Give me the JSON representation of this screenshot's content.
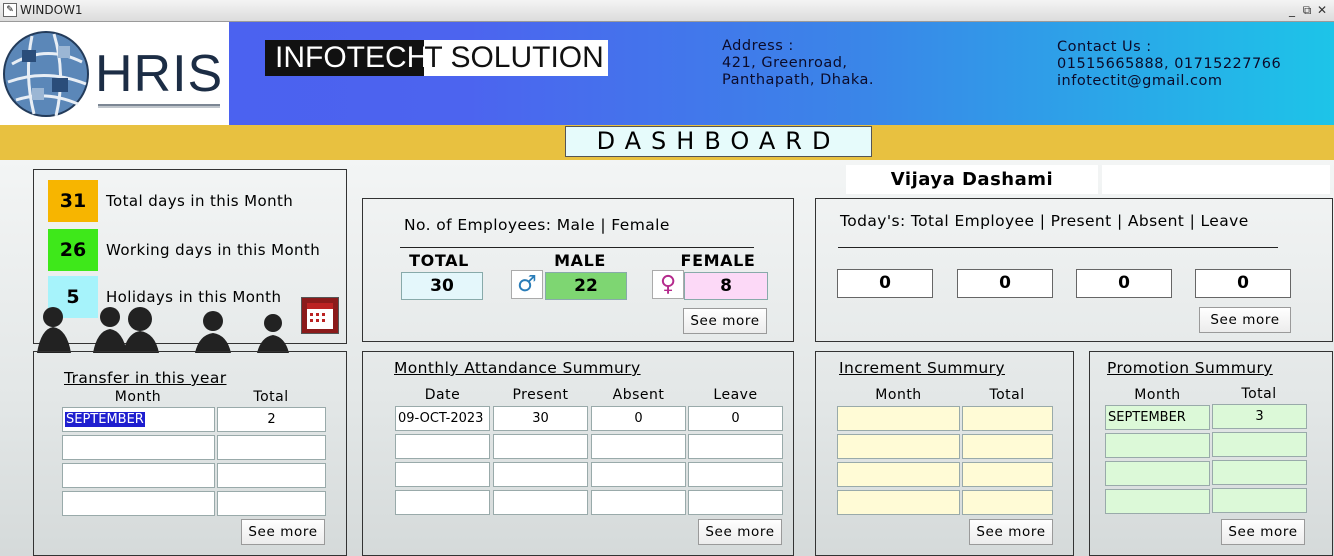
{
  "window": {
    "title": "WINDOW1",
    "controls": [
      "_",
      "⧉",
      "✕"
    ]
  },
  "header": {
    "logo_text": "HRIS",
    "company_part1": "INFOTECH",
    "company_part2": "T SOLUTION",
    "address": [
      "Address :",
      "421, Greenroad,",
      "Panthapath, Dhaka."
    ],
    "contact": [
      "Contact Us :",
      "01515665888, 01715227766",
      "infotectit@gmail.com"
    ]
  },
  "dashboard_title": "DASHBOARD",
  "calendar_stats": [
    {
      "value": "31",
      "label": "Total days in this Month",
      "color": "#f7b500"
    },
    {
      "value": "26",
      "label": "Working days in this Month",
      "color": "#3ee81a"
    },
    {
      "value": "5",
      "label": "Holidays in this Month",
      "color": "#a6f3fb"
    }
  ],
  "festival": "Vijaya Dashami",
  "employees": {
    "heading": "No. of Employees: Male | Female",
    "total_label": "TOTAL",
    "male_label": "MALE",
    "female_label": "FEMALE",
    "total": "30",
    "male": "22",
    "female": "8",
    "see_more": "See more"
  },
  "today": {
    "heading": "Today's: Total Employee | Present | Absent | Leave",
    "values": [
      "0",
      "0",
      "0",
      "0"
    ],
    "see_more": "See more"
  },
  "transfer": {
    "heading": "Transfer in this year",
    "columns": [
      "Month",
      "Total"
    ],
    "rows": [
      [
        "SEPTEMBER",
        "2"
      ],
      [
        "",
        ""
      ],
      [
        "",
        ""
      ],
      [
        "",
        ""
      ]
    ],
    "see_more": "See more"
  },
  "attendance": {
    "heading": "Monthly Attandance Summury",
    "columns": [
      "Date",
      "Present",
      "Absent",
      "Leave"
    ],
    "rows": [
      [
        "09-OCT-2023",
        "30",
        "0",
        "0"
      ],
      [
        "",
        "",
        "",
        ""
      ],
      [
        "",
        "",
        "",
        ""
      ],
      [
        "",
        "",
        "",
        ""
      ]
    ],
    "see_more": "See more"
  },
  "increment": {
    "heading": "Increment Summury",
    "columns": [
      "Month",
      "Total"
    ],
    "rows": [
      [
        "",
        ""
      ],
      [
        "",
        ""
      ],
      [
        "",
        ""
      ],
      [
        "",
        ""
      ]
    ],
    "see_more": "See more",
    "cell_color": "#fffbd6"
  },
  "promotion": {
    "heading": "Promotion Summury",
    "columns": [
      "Month",
      "Total"
    ],
    "rows": [
      [
        "SEPTEMBER",
        "3"
      ],
      [
        "",
        ""
      ],
      [
        "",
        ""
      ],
      [
        "",
        ""
      ]
    ],
    "see_more": "See more",
    "cell_color": "#dcf9d8"
  }
}
